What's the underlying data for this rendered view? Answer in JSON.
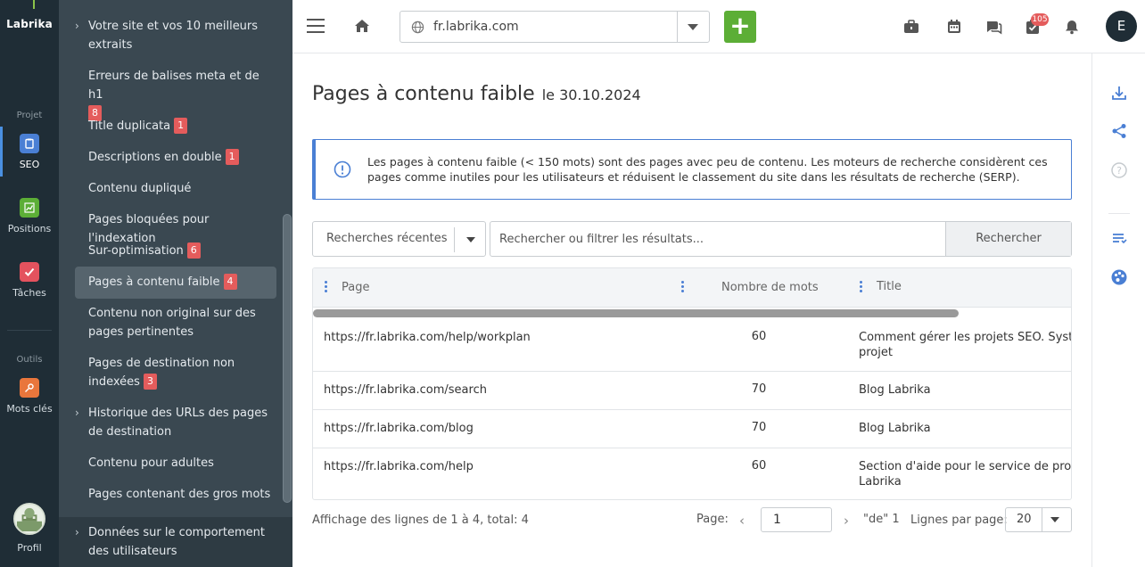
{
  "rail": {
    "logo": "Labrika",
    "section_project": "Projet",
    "section_tools": "Outils",
    "items": [
      {
        "label": "SEO",
        "color": "#4a7fd4"
      },
      {
        "label": "Positions",
        "color": "#5cae36"
      },
      {
        "label": "Tâches",
        "color": "#e4525e"
      },
      {
        "label": "Mots clés",
        "color": "#e9763c"
      },
      {
        "label": "Profil"
      }
    ]
  },
  "menu": {
    "items": [
      {
        "label": "Votre site et vos 10 meilleurs extraits",
        "chevron": true
      },
      {
        "label": "Erreurs de balises meta et de h1",
        "badge": "8"
      },
      {
        "label": "Title duplicata",
        "badge": "1"
      },
      {
        "label": "Descriptions en double",
        "badge": "1"
      },
      {
        "label": "Contenu dupliqué"
      },
      {
        "label": "Pages bloquées pour l'indexation"
      },
      {
        "label": "Sur-optimisation",
        "badge": "6"
      },
      {
        "label": "Pages à contenu faible",
        "badge": "4",
        "active": true
      },
      {
        "label": "Contenu non original sur des pages pertinentes"
      },
      {
        "label": "Pages de destination non indexées",
        "badge": "3"
      },
      {
        "label": "Historique des URLs des pages de destination",
        "chevron": true
      },
      {
        "label": "Contenu pour adultes"
      },
      {
        "label": "Pages contenant des gros mots"
      },
      {
        "label": "Données sur le comportement des utilisateurs",
        "chevron": true
      }
    ]
  },
  "topbar": {
    "url": "fr.labrika.com",
    "add_label": "+",
    "notif_count": "105",
    "user_initial": "E"
  },
  "page": {
    "title": "Pages à contenu faible",
    "date": "le 30.10.2024",
    "info": "Les pages à contenu faible (< 150 mots) sont des pages avec peu de contenu. Les moteurs de recherche considèrent ces pages comme inutiles pour les utilisateurs et réduisent le classement du site dans les résultats de recherche (SERP)."
  },
  "filters": {
    "recent_label": "Recherches récentes",
    "search_placeholder": "Rechercher ou filtrer les résultats...",
    "search_button": "Rechercher"
  },
  "table": {
    "columns": [
      "Page",
      "Nombre de mots",
      "Title"
    ],
    "rows": [
      {
        "page": "https://fr.labrika.com/help/workplan",
        "words": "60",
        "title": "Comment gérer les projets SEO. Système",
        "title2": "projet"
      },
      {
        "page": "https://fr.labrika.com/search",
        "words": "70",
        "title": "Blog Labrika",
        "title2": ""
      },
      {
        "page": "https://fr.labrika.com/blog",
        "words": "70",
        "title": "Blog Labrika",
        "title2": ""
      },
      {
        "page": "https://fr.labrika.com/help",
        "words": "60",
        "title": "Section d'aide pour le service de promot",
        "title2": "Labrika"
      }
    ]
  },
  "footer": {
    "info": "Affichage des lignes de 1 à 4, total: 4",
    "page_label": "Page:",
    "page_value": "1",
    "of_label": "\"de\" 1",
    "lines_label": "Lignes par page:",
    "lines_value": "20"
  }
}
